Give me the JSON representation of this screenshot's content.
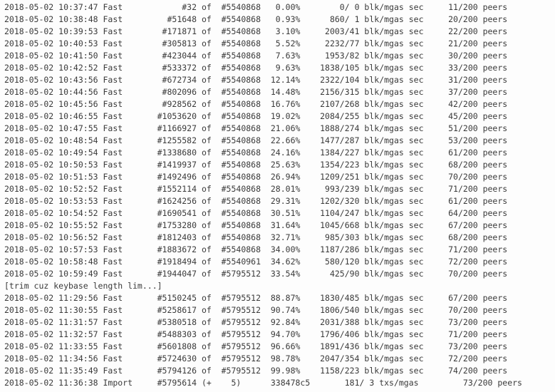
{
  "log": {
    "lines": [
      "2018-05-02 10:37:47 Fast            #32 of  #5540868   0.00%        0/ 0 blk/mgas sec     11/200 peers",
      "2018-05-02 10:38:48 Fast         #51648 of  #5540868   0.93%      860/ 1 blk/mgas sec     20/200 peers",
      "2018-05-02 10:39:53 Fast        #171871 of  #5540868   3.10%     2003/41 blk/mgas sec     22/200 peers",
      "2018-05-02 10:40:53 Fast        #305813 of  #5540868   5.52%     2232/77 blk/mgas sec     21/200 peers",
      "2018-05-02 10:41:50 Fast        #423044 of  #5540868   7.63%     1953/82 blk/mgas sec     30/200 peers",
      "2018-05-02 10:42:52 Fast        #533372 of  #5540868   9.63%    1838/105 blk/mgas sec     33/200 peers",
      "2018-05-02 10:43:56 Fast        #672734 of  #5540868  12.14%    2322/104 blk/mgas sec     31/200 peers",
      "2018-05-02 10:44:56 Fast        #802096 of  #5540868  14.48%    2156/315 blk/mgas sec     37/200 peers",
      "2018-05-02 10:45:56 Fast        #928562 of  #5540868  16.76%    2107/268 blk/mgas sec     42/200 peers",
      "2018-05-02 10:46:55 Fast       #1053620 of  #5540868  19.02%    2084/255 blk/mgas sec     45/200 peers",
      "2018-05-02 10:47:55 Fast       #1166927 of  #5540868  21.06%    1888/274 blk/mgas sec     51/200 peers",
      "2018-05-02 10:48:54 Fast       #1255582 of  #5540868  22.66%    1477/287 blk/mgas sec     53/200 peers",
      "2018-05-02 10:49:54 Fast       #1338680 of  #5540868  24.16%    1384/227 blk/mgas sec     61/200 peers",
      "2018-05-02 10:50:53 Fast       #1419937 of  #5540868  25.63%    1354/223 blk/mgas sec     68/200 peers",
      "2018-05-02 10:51:53 Fast       #1492496 of  #5540868  26.94%    1209/251 blk/mgas sec     70/200 peers",
      "2018-05-02 10:52:52 Fast       #1552114 of  #5540868  28.01%     993/239 blk/mgas sec     71/200 peers",
      "2018-05-02 10:53:53 Fast       #1624256 of  #5540868  29.31%    1202/320 blk/mgas sec     61/200 peers",
      "2018-05-02 10:54:52 Fast       #1690541 of  #5540868  30.51%    1104/247 blk/mgas sec     64/200 peers",
      "2018-05-02 10:55:52 Fast       #1753280 of  #5540868  31.64%    1045/668 blk/mgas sec     67/200 peers",
      "2018-05-02 10:56:52 Fast       #1812403 of  #5540868  32.71%     985/303 blk/mgas sec     68/200 peers",
      "2018-05-02 10:57:53 Fast       #1883672 of  #5540868  34.00%    1187/286 blk/mgas sec     71/200 peers",
      "2018-05-02 10:58:48 Fast       #1918494 of  #5540961  34.62%     580/120 blk/mgas sec     72/200 peers",
      "2018-05-02 10:59:49 Fast       #1944047 of  #5795512  33.54%      425/90 blk/mgas sec     70/200 peers",
      "[trim cuz keybase length lim...]",
      "2018-05-02 11:29:56 Fast       #5150245 of  #5795512  88.87%    1830/485 blk/mgas sec     67/200 peers",
      "2018-05-02 11:30:55 Fast       #5258617 of  #5795512  90.74%    1806/540 blk/mgas sec     70/200 peers",
      "2018-05-02 11:31:57 Fast       #5380518 of  #5795512  92.84%    2031/388 blk/mgas sec     73/200 peers",
      "2018-05-02 11:32:57 Fast       #5488303 of  #5795512  94.70%    1796/406 blk/mgas sec     71/200 peers",
      "2018-05-02 11:33:55 Fast       #5601808 of  #5795512  96.66%    1891/436 blk/mgas sec     73/200 peers",
      "2018-05-02 11:34:56 Fast       #5724630 of  #5795512  98.78%    2047/354 blk/mgas sec     72/200 peers",
      "2018-05-02 11:35:49 Fast       #5794126 of  #5795512  99.98%    1158/223 blk/mgas sec     74/200 peers",
      "2018-05-02 11:36:38 Import     #5795614 (+    5)      338478c5       181/ 3 txs/mgas         73/200 peers"
    ]
  }
}
